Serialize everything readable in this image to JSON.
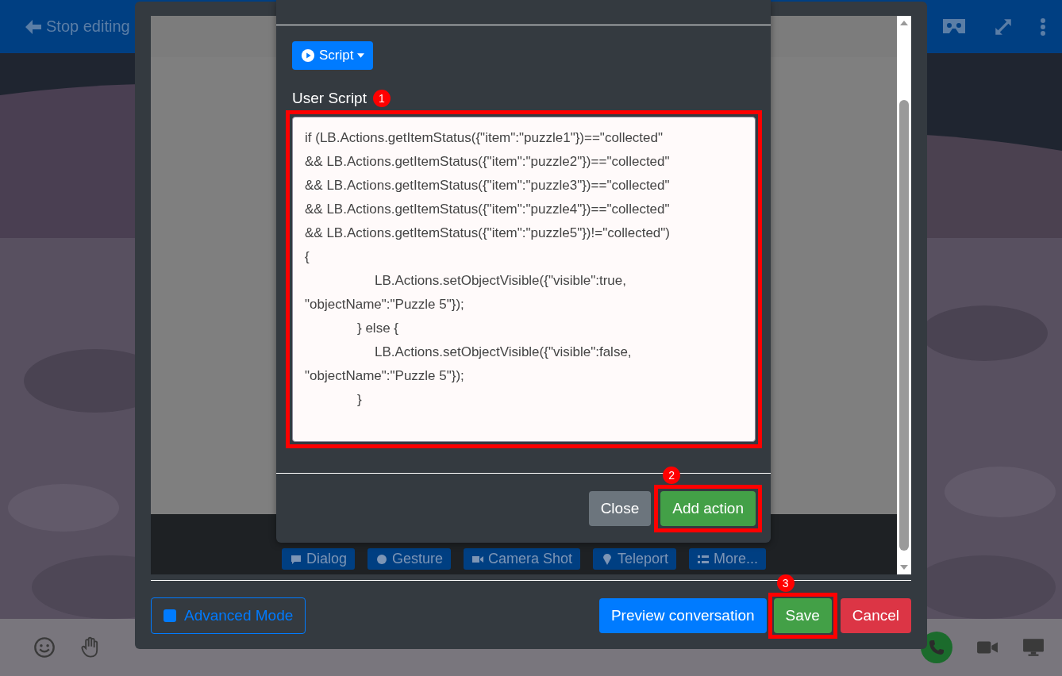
{
  "top_bar": {
    "back_label": "Stop editing"
  },
  "dialog": {
    "action_buttons": [
      {
        "label": "Dialog",
        "kind": "dialog"
      },
      {
        "label": "Gesture",
        "kind": "gesture"
      },
      {
        "label": "Camera Shot",
        "kind": "camera"
      },
      {
        "label": "Teleport",
        "kind": "teleport"
      },
      {
        "label": "More...",
        "kind": "more"
      }
    ],
    "advanced_mode": {
      "label": "Advanced Mode",
      "checked": true
    },
    "footer_buttons": [
      {
        "label": "Preview conversation",
        "kind": "primary"
      },
      {
        "label": "Save",
        "kind": "success",
        "callout": "3"
      },
      {
        "label": "Cancel",
        "kind": "danger"
      }
    ]
  },
  "script_dialog": {
    "type_button": "Script",
    "field_label": "User Script",
    "field_callout": "1",
    "script": "if (LB.Actions.getItemStatus({\"item\":\"puzzle1\"})==\"collected\"\n&& LB.Actions.getItemStatus({\"item\":\"puzzle2\"})==\"collected\"\n&& LB.Actions.getItemStatus({\"item\":\"puzzle3\"})==\"collected\"\n&& LB.Actions.getItemStatus({\"item\":\"puzzle4\"})==\"collected\"\n&& LB.Actions.getItemStatus({\"item\":\"puzzle5\"})!=\"collected\")\n{\n\t\t\t\tLB.Actions.setObjectVisible({\"visible\":true,\n\"objectName\":\"Puzzle 5\"});\n\t\t\t} else {\n\t\t\t\tLB.Actions.setObjectVisible({\"visible\":false,\n\"objectName\":\"Puzzle 5\"});\n\t\t\t}",
    "buttons": [
      {
        "label": "Close",
        "kind": "secondary"
      },
      {
        "label": "Add action",
        "kind": "success",
        "callout": "2"
      }
    ]
  }
}
